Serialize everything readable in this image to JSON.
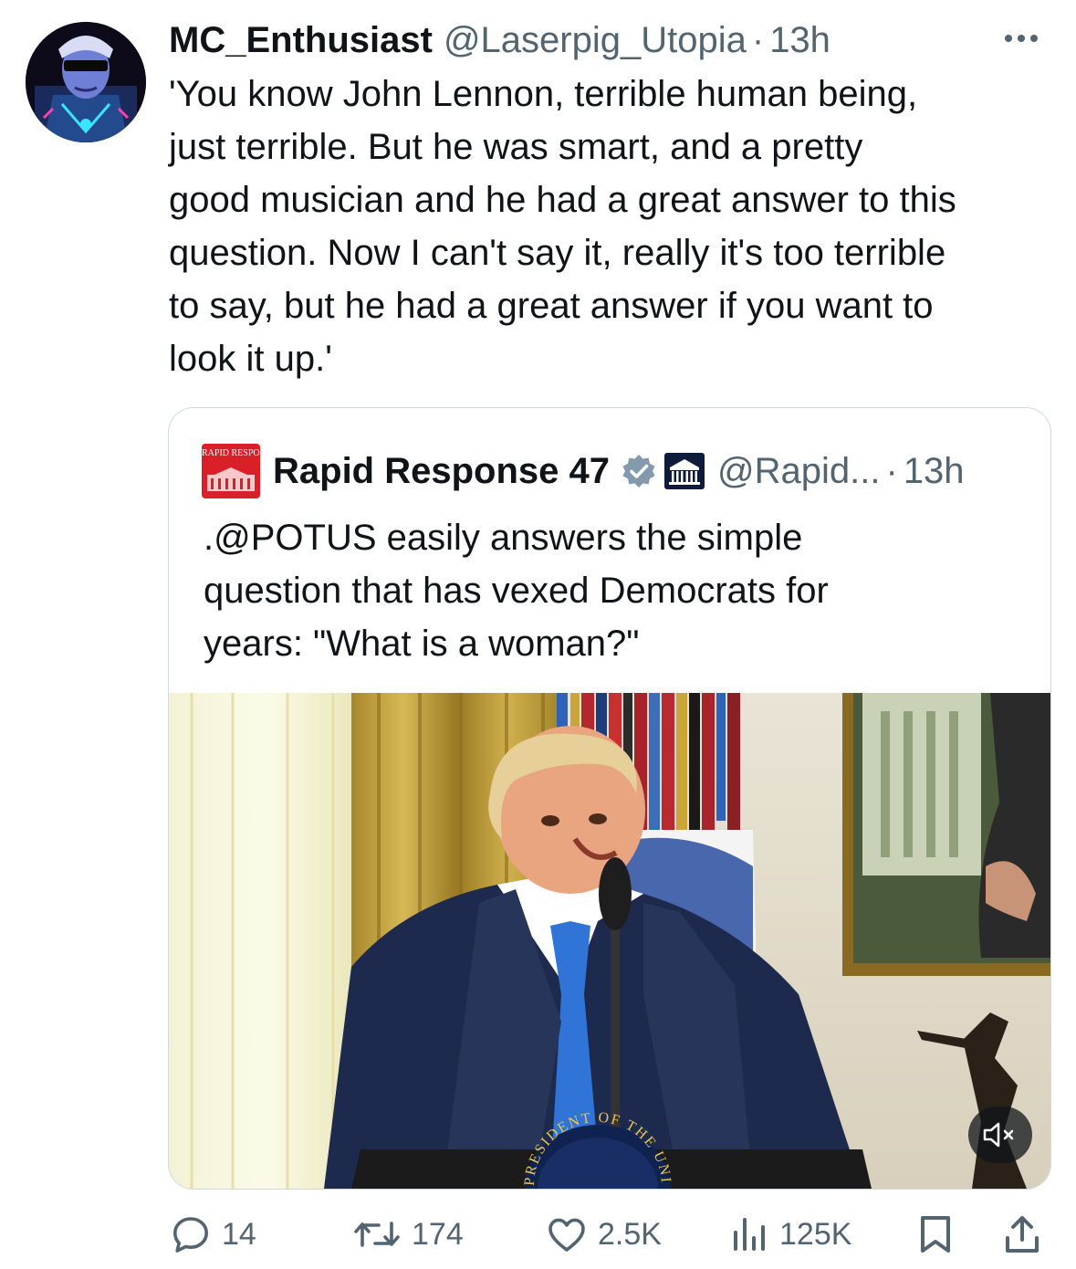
{
  "tweet": {
    "display_name": "MC_Enthusiast",
    "handle": "@Laserpig_Utopia",
    "separator": "·",
    "time": "13h",
    "text": "'You know John Lennon, terrible human being,\njust terrible. But he was smart, and a pretty\ngood musician and he had a great answer to this\nquestion. Now I can't say it, really it's too terrible\nto say, but he had a great answer if you want to\nlook it up.'",
    "avatar_icon": "avatar-icon",
    "more_icon": "more-icon"
  },
  "quoted": {
    "avatar_text": "RAPID RESPONSE",
    "display_name": "Rapid Response 47",
    "handle": "@Rapid...",
    "separator": "·",
    "time": "13h",
    "verified_icon": "verified-badge-icon",
    "affiliation_icon": "white-house-icon",
    "text": ".@POTUS easily answers the simple\nquestion that has vexed Democrats for\nyears: \"What is a woman?\"",
    "media": {
      "type": "video",
      "seal_text": "PRESIDENT OF THE UNITE",
      "mute_icon": "mute-icon"
    }
  },
  "actions": {
    "replies": "14",
    "reposts": "174",
    "likes": "2.5K",
    "views": "125K",
    "icons": [
      "reply-icon",
      "repost-icon",
      "like-icon",
      "views-icon",
      "bookmark-icon",
      "share-icon"
    ]
  },
  "colors": {
    "text_primary": "#0f1419",
    "text_secondary": "#536471",
    "border": "#cfd9de",
    "verified": "#829aab",
    "rapid_response_red": "#d91f27"
  }
}
